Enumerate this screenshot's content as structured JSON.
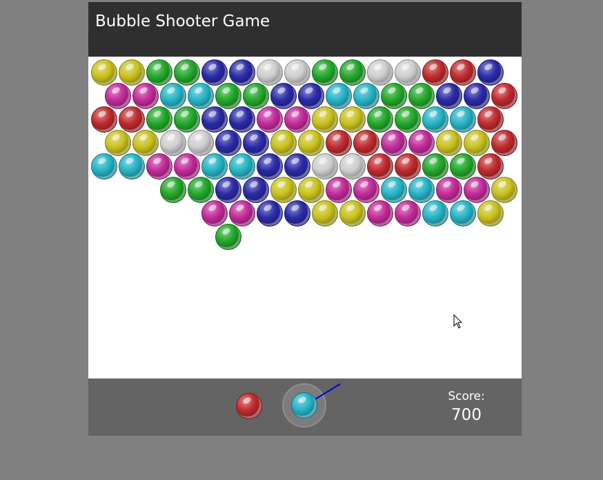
{
  "header": {
    "title": "Bubble Shooter Game"
  },
  "colors": {
    "Y": "#c9c21e",
    "G": "#22a82a",
    "B": "#2a2aa8",
    "W": "#cfcfcf",
    "R": "#c02a2e",
    "M": "#c22a9a",
    "C": "#25b4c6"
  },
  "grid": {
    "rows": [
      "YYGGBBWWGGWWRRB",
      "MMCCGGBBCCGGBBR",
      "RRGGBBMMYYGGCCR",
      "YYWWBBYYRRMMYYR",
      "CCMMCCBBWWRRGGR",
      "..GGBBYYMMCCMMY",
      "....MMBBYYMMCCY",
      "....G.........."
    ]
  },
  "footer": {
    "next_bubble_color": "R",
    "current_bubble_color": "C",
    "score_label": "Score:",
    "score_value": "700"
  }
}
